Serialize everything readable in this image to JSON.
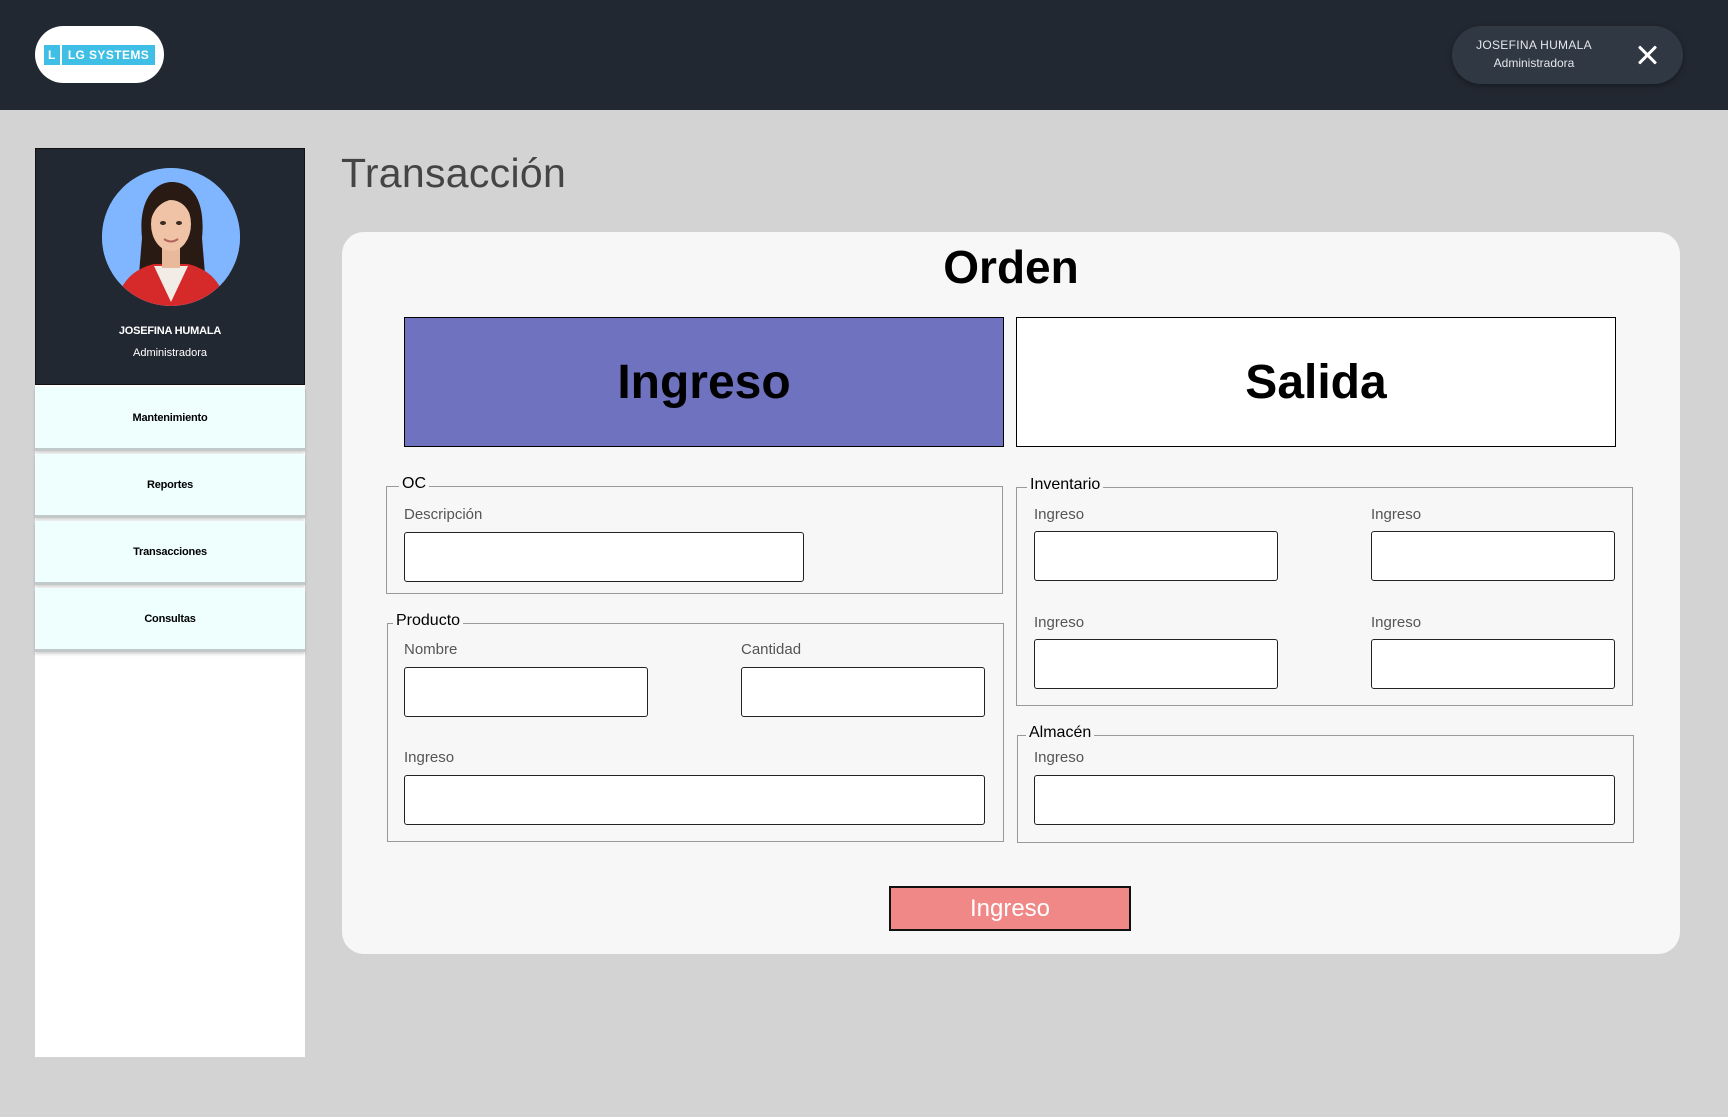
{
  "header": {
    "logo_mark": "L",
    "logo_text": "LG SYSTEMS",
    "user_name": "JOSEFINA HUMALA",
    "user_role": "Administradora"
  },
  "sidebar": {
    "profile_name": "JOSEFINA HUMALA",
    "profile_role": "Administradora",
    "items": [
      {
        "label": "Mantenimiento"
      },
      {
        "label": "Reportes"
      },
      {
        "label": "Transacciones"
      },
      {
        "label": "Consultas"
      }
    ]
  },
  "main": {
    "page_title": "Transacción",
    "card_title": "Orden",
    "tabs": [
      {
        "label": "Ingreso",
        "active": true
      },
      {
        "label": "Salida",
        "active": false
      }
    ],
    "oc": {
      "legend": "OC",
      "fields": [
        {
          "label": "Descripción",
          "value": ""
        }
      ]
    },
    "producto": {
      "legend": "Producto",
      "fields": [
        {
          "label": "Nombre",
          "value": ""
        },
        {
          "label": "Cantidad",
          "value": ""
        },
        {
          "label": "Ingreso",
          "value": ""
        }
      ]
    },
    "inventario": {
      "legend": "Inventario",
      "fields": [
        {
          "label": "Ingreso",
          "value": ""
        },
        {
          "label": "Ingreso",
          "value": ""
        },
        {
          "label": "Ingreso",
          "value": ""
        },
        {
          "label": "Ingreso",
          "value": ""
        }
      ]
    },
    "almacen": {
      "legend": "Almacén",
      "fields": [
        {
          "label": "Ingreso",
          "value": ""
        }
      ]
    },
    "submit_label": "Ingreso"
  },
  "colors": {
    "topbar": "#222831",
    "active_tab": "#6f73bf",
    "submit": "#f08888",
    "logo": "#3fbfe6",
    "nav_item": "#eefffe"
  }
}
